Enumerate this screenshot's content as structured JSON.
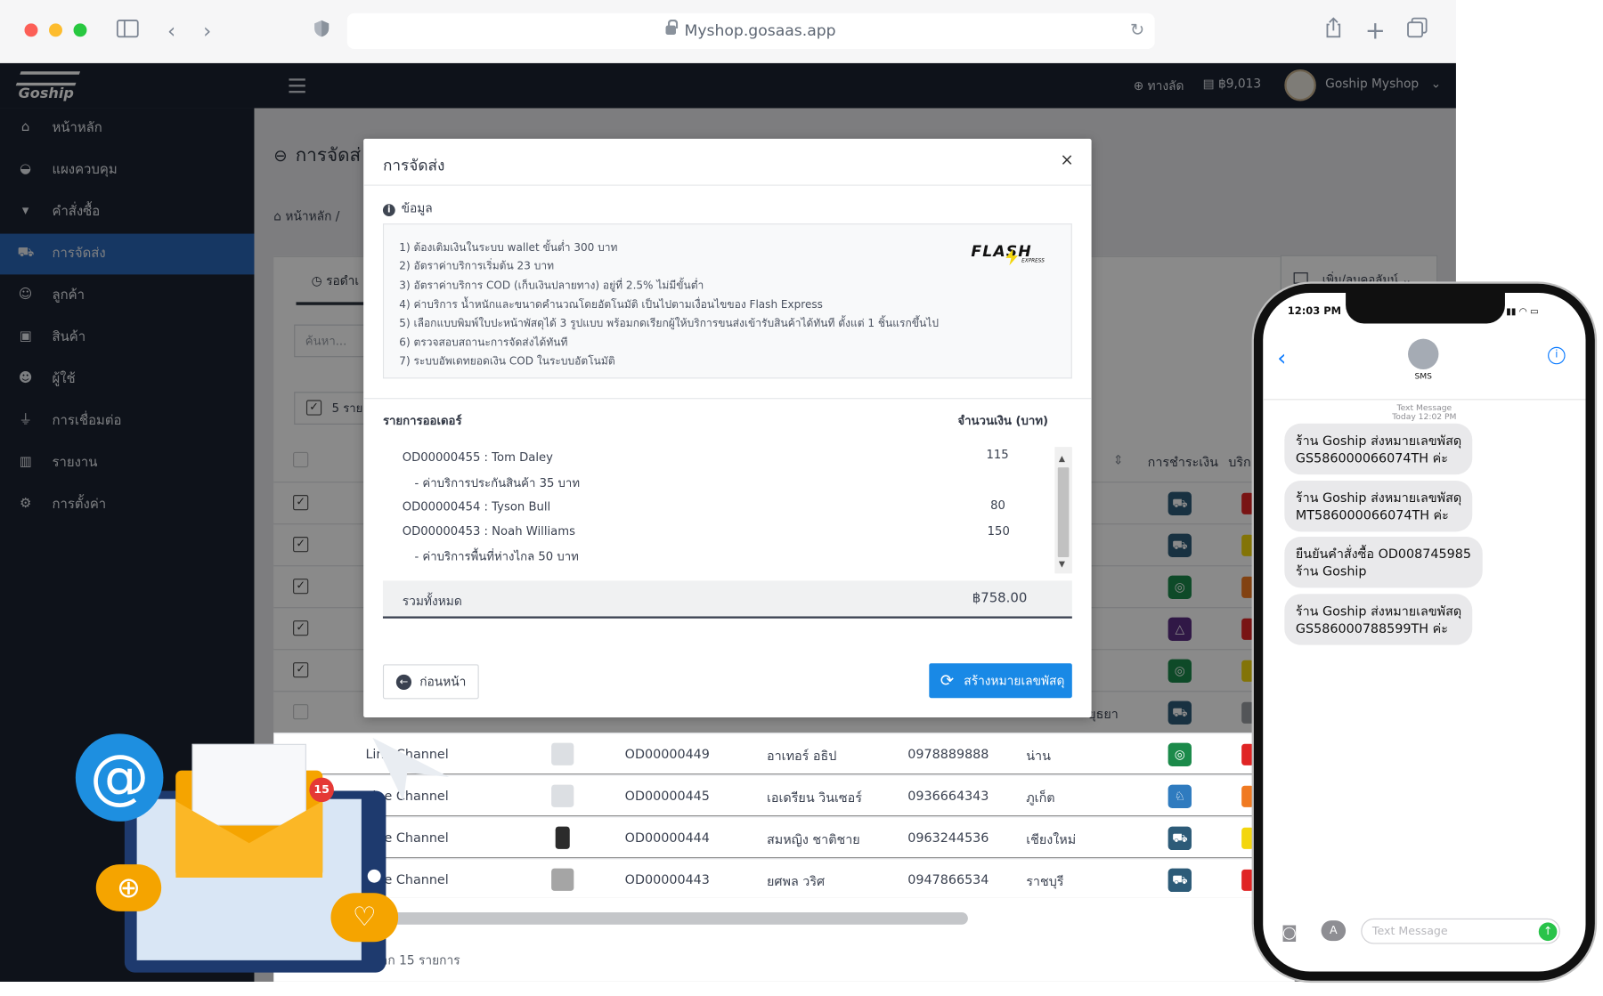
{
  "browser": {
    "url": "Myshop.gosaas.app"
  },
  "topbar": {
    "shortcut_label": "ทางลัด",
    "balance": "฿9,013",
    "shop_name": "Goship Myshop"
  },
  "logo": {
    "text": "Goship"
  },
  "sidebar": {
    "items": [
      {
        "label": "หน้าหลัก",
        "icon": "home-icon"
      },
      {
        "label": "แผงควบคุม",
        "icon": "dashboard-icon"
      },
      {
        "label": "คำสั่งซื้อ",
        "icon": "cart-icon"
      },
      {
        "label": "การจัดส่ง",
        "icon": "truck-icon",
        "active": true
      },
      {
        "label": "ลูกค้า",
        "icon": "users-icon"
      },
      {
        "label": "สินค้า",
        "icon": "box-icon"
      },
      {
        "label": "ผู้ใช้",
        "icon": "user-cog-icon"
      },
      {
        "label": "การเชื่อมต่อ",
        "icon": "plug-icon"
      },
      {
        "label": "รายงาน",
        "icon": "chart-icon"
      },
      {
        "label": "การตั้งค่า",
        "icon": "gear-icon"
      }
    ]
  },
  "page": {
    "title": "การจัดส่",
    "breadcrumb_home": "หน้าหลัก",
    "tab_pending": "รอดำเ",
    "search_placeholder": "ค้นหา...",
    "selected_count": "5 ราย",
    "add_column_btn": "เพิ่ม/ลบคอลัมน์",
    "col_payment": "การชำระเงิน",
    "col_service": "บริก",
    "footer_text": "แสดง 1 ถึง 10 จาก 15 รายการ",
    "province_partial": "ยุธยา"
  },
  "table_rows": [
    {
      "channel": "Line Channel",
      "order": "OD00000449",
      "name": "อาเทอร์ อธิป",
      "phone": "0978889888",
      "province": "น่าน"
    },
    {
      "channel": "Line Channel",
      "order": "OD00000445",
      "name": "เอเดรียน วินเซอร์",
      "phone": "0936664343",
      "province": "ภูเก็ต"
    },
    {
      "channel": "Line Channel",
      "order": "OD00000444",
      "name": "สมหญิง ชาติชาย",
      "phone": "0963244536",
      "province": "เชียงใหม่"
    },
    {
      "channel": "Line Channel",
      "order": "OD00000443",
      "name": "ยศพล วริศ",
      "phone": "0947866534",
      "province": "ราชบุรี"
    }
  ],
  "modal": {
    "title": "การจัดส่ง",
    "info_label": "ข้อมูล",
    "info_lines": [
      "1) ต้องเติมเงินในระบบ wallet ขั้นต่ำ 300 บาท",
      "2) อัตราค่าบริการเริ่มต้น 23 บาท",
      "3) อัตราค่าบริการ COD (เก็บเงินปลายทาง) อยู่ที่ 2.5% ไม่มีขั้นต่ำ",
      "4) ค่าบริการ น้ำหนักและขนาดคำนวณโดยอัตโนมัติ เป็นไปตามเงื่อนไขของ Flash Express",
      "5) เลือกแบบพิมพ์ใบปะหน้าพัสดุได้ 3 รูปแบบ พร้อมกดเรียกผู้ให้บริการขนส่งเข้ารับสินค้าได้ทันที ตั้งแต่ 1 ชิ้นแรกขึ้นไป",
      "6) ตรวจสอบสถานะการจัดส่งได้ทันที",
      "7) ระบบอัพเดทยอดเงิน COD ในระบบอัตโนมัติ"
    ],
    "carrier_logo": "FLASH",
    "carrier_sub": "EXPRESS",
    "orders_header": "รายการออเดอร์",
    "amount_header": "จำนวนเงิน (บาท)",
    "orders": [
      {
        "label": "OD00000455 : Tom Daley",
        "amount": "115"
      },
      {
        "label": "- ค่าบริการประกันสินค้า 35 บาท",
        "amount": ""
      },
      {
        "label": "OD00000454 : Tyson Bull",
        "amount": "80"
      },
      {
        "label": "OD00000453 : Noah Williams",
        "amount": "150"
      },
      {
        "label": "- ค่าบริการพื้นที่ห่างไกล 50 บาท",
        "amount": ""
      }
    ],
    "total_label": "รวมทั้งหมด",
    "total_value": "฿758.00",
    "prev_button": "ก่อนหน้า",
    "create_button": "สร้างหมายเลขพัสดุ"
  },
  "phone": {
    "time": "12:03 PM",
    "contact": "SMS",
    "meta_line1": "Text Message",
    "meta_line2": "Today 12:02 PM",
    "messages": [
      {
        "line1": "ร้าน Goship ส่งหมายเลขพัสดุ",
        "line2": "GS586000066074TH ค่ะ"
      },
      {
        "line1": "ร้าน Goship ส่งหมายเลขพัสดุ",
        "line2": "MT586000066074TH ค่ะ"
      },
      {
        "line1": "ยืนยันคำสั่งซื้อ OD008745985",
        "line2": "ร้าน Goship"
      },
      {
        "line1": "ร้าน Goship ส่งหมายเลขพัสดุ",
        "line2": "GS586000788599TH ค่ะ"
      }
    ],
    "input_placeholder": "Text Message"
  },
  "illustration": {
    "badge_count": "15",
    "at_symbol": "@"
  },
  "colors": {
    "sidebar": "#1b2230",
    "accent": "#2a66b7",
    "primary_button": "#1989e6"
  }
}
